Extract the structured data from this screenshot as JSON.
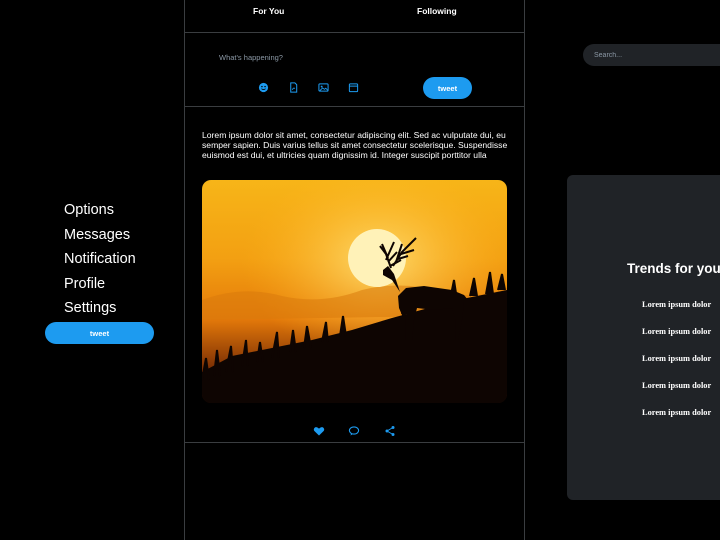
{
  "nav": {
    "items": [
      {
        "label": "Options"
      },
      {
        "label": "Messages"
      },
      {
        "label": "Notification"
      },
      {
        "label": "Profile"
      },
      {
        "label": "Settings"
      }
    ],
    "tweet_label": "tweet"
  },
  "tabs": {
    "for_you": "For You",
    "following": "Following"
  },
  "composer": {
    "placeholder": "What's happening?",
    "icons": [
      "emoji-icon",
      "document-icon",
      "image-icon",
      "calendar-icon"
    ],
    "tweet_label": "tweet"
  },
  "post": {
    "text": "Lorem ipsum dolor sit amet, consectetur adipiscing elit. Sed ac vulputate dui, eu semper sapien. Duis varius tellus sit amet consectetur scelerisque. Suspendisse euismod est dui, et ultricies quam dignissim id. Integer suscipit porttitor ulla",
    "image_subject": "deer silhouette at sunset",
    "actions": [
      "heart-icon",
      "comment-icon",
      "share-icon"
    ]
  },
  "search": {
    "placeholder": "Search..."
  },
  "trends": {
    "title": "Trends for you",
    "items": [
      {
        "label": "Lorem ipsum dolor"
      },
      {
        "label": "Lorem ipsum dolor"
      },
      {
        "label": "Lorem ipsum dolor"
      },
      {
        "label": "Lorem ipsum dolor"
      },
      {
        "label": "Lorem ipsum dolor"
      }
    ]
  },
  "colors": {
    "background": "#000000",
    "accent": "#1d9bf0",
    "panel": "#202327",
    "divider": "#3a3d40"
  }
}
